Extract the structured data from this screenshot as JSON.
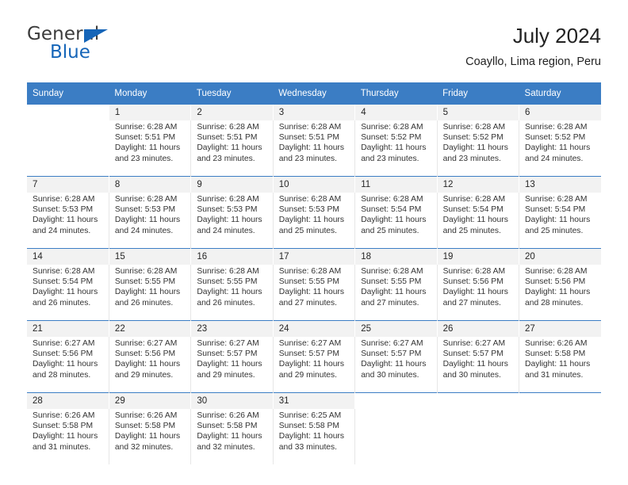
{
  "brand": {
    "name_top": "General",
    "name_bottom": "Blue",
    "triangle_color": "#1565b8",
    "top_text_color": "#3b3b3b"
  },
  "header": {
    "title": "July 2024",
    "subtitle": "Coayllo, Lima region, Peru"
  },
  "theme": {
    "header_row_bg": "#3b7dc4",
    "header_row_text": "#ffffff",
    "daynum_bg": "#f2f2f2",
    "week_divider": "#3b7dc4",
    "cell_divider": "#e6e6e6"
  },
  "calendar": {
    "weekday_headers": [
      "Sunday",
      "Monday",
      "Tuesday",
      "Wednesday",
      "Thursday",
      "Friday",
      "Saturday"
    ],
    "weeks": [
      [
        {
          "day": "",
          "lines": []
        },
        {
          "day": "1",
          "lines": [
            "Sunrise: 6:28 AM",
            "Sunset: 5:51 PM",
            "Daylight: 11 hours",
            "and 23 minutes."
          ]
        },
        {
          "day": "2",
          "lines": [
            "Sunrise: 6:28 AM",
            "Sunset: 5:51 PM",
            "Daylight: 11 hours",
            "and 23 minutes."
          ]
        },
        {
          "day": "3",
          "lines": [
            "Sunrise: 6:28 AM",
            "Sunset: 5:51 PM",
            "Daylight: 11 hours",
            "and 23 minutes."
          ]
        },
        {
          "day": "4",
          "lines": [
            "Sunrise: 6:28 AM",
            "Sunset: 5:52 PM",
            "Daylight: 11 hours",
            "and 23 minutes."
          ]
        },
        {
          "day": "5",
          "lines": [
            "Sunrise: 6:28 AM",
            "Sunset: 5:52 PM",
            "Daylight: 11 hours",
            "and 23 minutes."
          ]
        },
        {
          "day": "6",
          "lines": [
            "Sunrise: 6:28 AM",
            "Sunset: 5:52 PM",
            "Daylight: 11 hours",
            "and 24 minutes."
          ]
        }
      ],
      [
        {
          "day": "7",
          "lines": [
            "Sunrise: 6:28 AM",
            "Sunset: 5:53 PM",
            "Daylight: 11 hours",
            "and 24 minutes."
          ]
        },
        {
          "day": "8",
          "lines": [
            "Sunrise: 6:28 AM",
            "Sunset: 5:53 PM",
            "Daylight: 11 hours",
            "and 24 minutes."
          ]
        },
        {
          "day": "9",
          "lines": [
            "Sunrise: 6:28 AM",
            "Sunset: 5:53 PM",
            "Daylight: 11 hours",
            "and 24 minutes."
          ]
        },
        {
          "day": "10",
          "lines": [
            "Sunrise: 6:28 AM",
            "Sunset: 5:53 PM",
            "Daylight: 11 hours",
            "and 25 minutes."
          ]
        },
        {
          "day": "11",
          "lines": [
            "Sunrise: 6:28 AM",
            "Sunset: 5:54 PM",
            "Daylight: 11 hours",
            "and 25 minutes."
          ]
        },
        {
          "day": "12",
          "lines": [
            "Sunrise: 6:28 AM",
            "Sunset: 5:54 PM",
            "Daylight: 11 hours",
            "and 25 minutes."
          ]
        },
        {
          "day": "13",
          "lines": [
            "Sunrise: 6:28 AM",
            "Sunset: 5:54 PM",
            "Daylight: 11 hours",
            "and 25 minutes."
          ]
        }
      ],
      [
        {
          "day": "14",
          "lines": [
            "Sunrise: 6:28 AM",
            "Sunset: 5:54 PM",
            "Daylight: 11 hours",
            "and 26 minutes."
          ]
        },
        {
          "day": "15",
          "lines": [
            "Sunrise: 6:28 AM",
            "Sunset: 5:55 PM",
            "Daylight: 11 hours",
            "and 26 minutes."
          ]
        },
        {
          "day": "16",
          "lines": [
            "Sunrise: 6:28 AM",
            "Sunset: 5:55 PM",
            "Daylight: 11 hours",
            "and 26 minutes."
          ]
        },
        {
          "day": "17",
          "lines": [
            "Sunrise: 6:28 AM",
            "Sunset: 5:55 PM",
            "Daylight: 11 hours",
            "and 27 minutes."
          ]
        },
        {
          "day": "18",
          "lines": [
            "Sunrise: 6:28 AM",
            "Sunset: 5:55 PM",
            "Daylight: 11 hours",
            "and 27 minutes."
          ]
        },
        {
          "day": "19",
          "lines": [
            "Sunrise: 6:28 AM",
            "Sunset: 5:56 PM",
            "Daylight: 11 hours",
            "and 27 minutes."
          ]
        },
        {
          "day": "20",
          "lines": [
            "Sunrise: 6:28 AM",
            "Sunset: 5:56 PM",
            "Daylight: 11 hours",
            "and 28 minutes."
          ]
        }
      ],
      [
        {
          "day": "21",
          "lines": [
            "Sunrise: 6:27 AM",
            "Sunset: 5:56 PM",
            "Daylight: 11 hours",
            "and 28 minutes."
          ]
        },
        {
          "day": "22",
          "lines": [
            "Sunrise: 6:27 AM",
            "Sunset: 5:56 PM",
            "Daylight: 11 hours",
            "and 29 minutes."
          ]
        },
        {
          "day": "23",
          "lines": [
            "Sunrise: 6:27 AM",
            "Sunset: 5:57 PM",
            "Daylight: 11 hours",
            "and 29 minutes."
          ]
        },
        {
          "day": "24",
          "lines": [
            "Sunrise: 6:27 AM",
            "Sunset: 5:57 PM",
            "Daylight: 11 hours",
            "and 29 minutes."
          ]
        },
        {
          "day": "25",
          "lines": [
            "Sunrise: 6:27 AM",
            "Sunset: 5:57 PM",
            "Daylight: 11 hours",
            "and 30 minutes."
          ]
        },
        {
          "day": "26",
          "lines": [
            "Sunrise: 6:27 AM",
            "Sunset: 5:57 PM",
            "Daylight: 11 hours",
            "and 30 minutes."
          ]
        },
        {
          "day": "27",
          "lines": [
            "Sunrise: 6:26 AM",
            "Sunset: 5:58 PM",
            "Daylight: 11 hours",
            "and 31 minutes."
          ]
        }
      ],
      [
        {
          "day": "28",
          "lines": [
            "Sunrise: 6:26 AM",
            "Sunset: 5:58 PM",
            "Daylight: 11 hours",
            "and 31 minutes."
          ]
        },
        {
          "day": "29",
          "lines": [
            "Sunrise: 6:26 AM",
            "Sunset: 5:58 PM",
            "Daylight: 11 hours",
            "and 32 minutes."
          ]
        },
        {
          "day": "30",
          "lines": [
            "Sunrise: 6:26 AM",
            "Sunset: 5:58 PM",
            "Daylight: 11 hours",
            "and 32 minutes."
          ]
        },
        {
          "day": "31",
          "lines": [
            "Sunrise: 6:25 AM",
            "Sunset: 5:58 PM",
            "Daylight: 11 hours",
            "and 33 minutes."
          ]
        },
        {
          "day": "",
          "lines": []
        },
        {
          "day": "",
          "lines": []
        },
        {
          "day": "",
          "lines": []
        }
      ]
    ]
  }
}
